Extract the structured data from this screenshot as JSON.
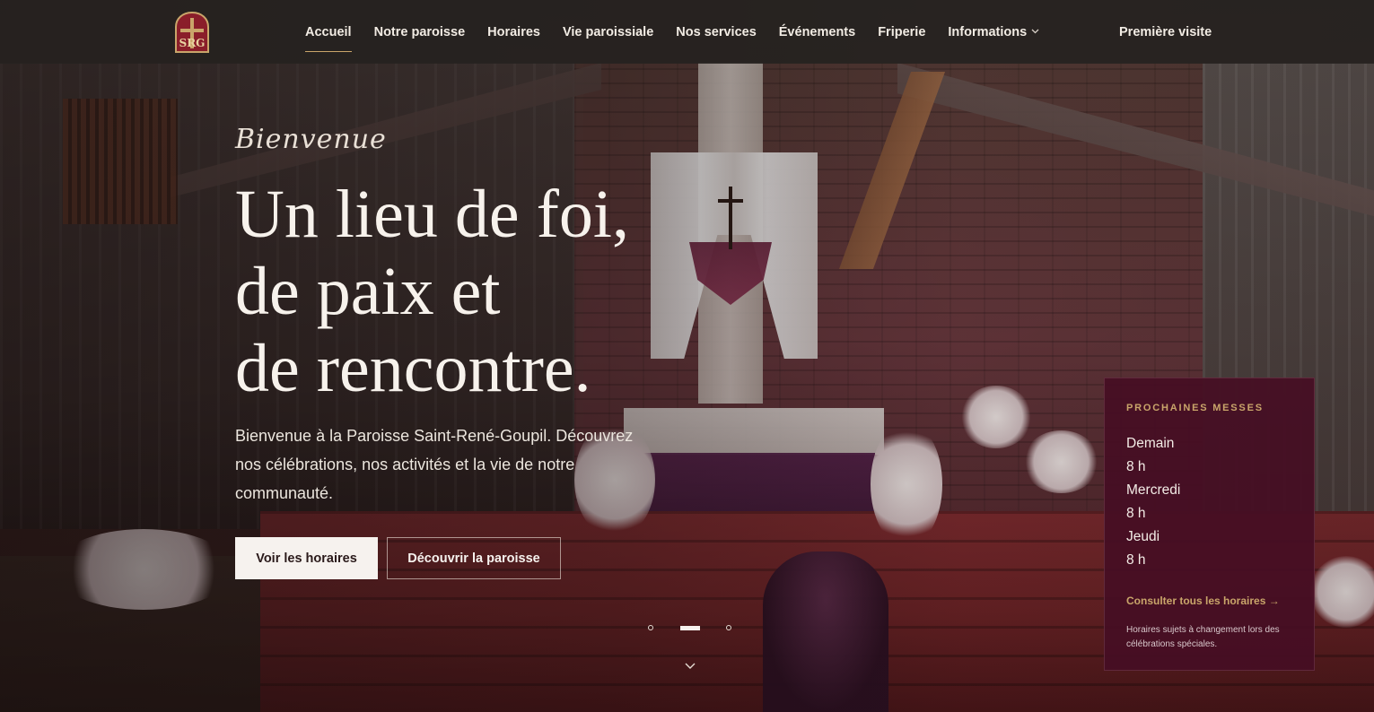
{
  "header": {
    "logo_text": "SRG",
    "nav": [
      {
        "label": "Accueil",
        "active": true
      },
      {
        "label": "Notre paroisse",
        "active": false
      },
      {
        "label": "Horaires",
        "active": false
      },
      {
        "label": "Vie paroissiale",
        "active": false
      },
      {
        "label": "Nos services",
        "active": false
      },
      {
        "label": "Événements",
        "active": false
      },
      {
        "label": "Friperie",
        "active": false
      },
      {
        "label": "Informations",
        "active": false,
        "has_dropdown": true
      }
    ],
    "cta": "Première visite"
  },
  "hero": {
    "eyebrow": "Bienvenue",
    "headline": [
      "Un lieu de foi,",
      "de paix et",
      "de rencontre."
    ],
    "intro": "Bienvenue à la Paroisse Saint-René-Goupil. Découvrez nos célébrations, nos activités et la vie de notre communauté.",
    "primary_button": "Voir les horaires",
    "secondary_button": "Découvrir la paroisse",
    "slider": {
      "total": 3,
      "active_index": 1
    }
  },
  "mass_card": {
    "title": "PROCHAINES MESSES",
    "entries": [
      {
        "day": "Demain",
        "time": "8 h"
      },
      {
        "day": "Mercredi",
        "time": "8 h"
      },
      {
        "day": "Jeudi",
        "time": "8 h"
      }
    ],
    "link": "Consulter tous les horaires →",
    "note": "Horaires sujets à changement lors des célébrations spéciales."
  },
  "colors": {
    "accent_gold": "#c9a56a",
    "card_bg": "#460e24",
    "header_bg": "#262220"
  },
  "icons": {
    "dropdown": "chevron-down-icon",
    "scroll": "chevron-down-icon"
  }
}
